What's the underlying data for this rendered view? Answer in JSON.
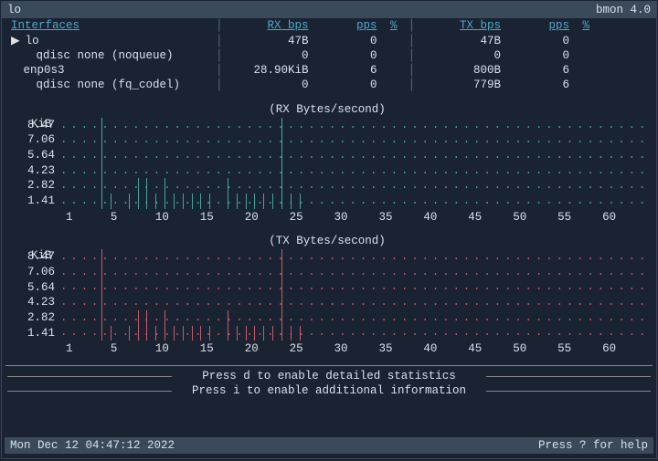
{
  "titlebar": {
    "left": "lo",
    "right": "bmon 4.0"
  },
  "table": {
    "headers": {
      "interfaces": "Interfaces",
      "rxbps": "RX bps",
      "pps1": "pps",
      "pct1": "%",
      "txbps": "TX bps",
      "pps2": "pps",
      "pct2": "%"
    },
    "rows": [
      {
        "name": "lo",
        "rx": "47B",
        "rxpps": "0",
        "tx": "47B",
        "txpps": "0",
        "selected": true,
        "indent": 1
      },
      {
        "name": "qdisc none (noqueue)",
        "rx": "0",
        "rxpps": "0",
        "tx": "0",
        "txpps": "0",
        "indent": 2
      },
      {
        "name": "enp0s3",
        "rx": "28.90KiB",
        "rxpps": "6",
        "tx": "800B",
        "txpps": "6",
        "indent": 1
      },
      {
        "name": "qdisc none (fq_codel)",
        "rx": "0",
        "rxpps": "0",
        "tx": "779B",
        "txpps": "6",
        "indent": 2
      }
    ]
  },
  "charts": {
    "rx": {
      "title": "(RX Bytes/second)",
      "unit": "KiB"
    },
    "tx": {
      "title": "(TX Bytes/second)",
      "unit": "KiB"
    },
    "y_ticks": [
      "8.47",
      "7.06",
      "5.64",
      "4.23",
      "2.82",
      "1.41"
    ],
    "x_ticks": [
      "1",
      "5",
      "10",
      "15",
      "20",
      "25",
      "30",
      "35",
      "40",
      "45",
      "50",
      "55",
      "60"
    ]
  },
  "chart_data": [
    {
      "type": "bar",
      "title": "(RX Bytes/second)",
      "ylabel": "KiB",
      "ylim": [
        0,
        8.47
      ],
      "series": [
        {
          "name": "RX",
          "x": [
            5,
            6,
            8,
            9,
            10,
            11,
            12,
            13,
            14,
            15,
            16,
            17,
            19,
            20,
            21,
            22,
            23,
            24,
            25,
            26,
            27
          ],
          "values": [
            8.47,
            1.41,
            1.41,
            2.82,
            2.82,
            1.41,
            2.82,
            1.41,
            1.41,
            1.41,
            1.41,
            1.41,
            2.82,
            1.41,
            1.41,
            1.41,
            1.41,
            1.41,
            8.47,
            1.41,
            1.41
          ]
        }
      ]
    },
    {
      "type": "bar",
      "title": "(TX Bytes/second)",
      "ylabel": "KiB",
      "ylim": [
        0,
        8.47
      ],
      "series": [
        {
          "name": "TX",
          "x": [
            5,
            6,
            8,
            9,
            10,
            11,
            12,
            13,
            14,
            15,
            16,
            17,
            19,
            20,
            21,
            22,
            23,
            24,
            25,
            26,
            27
          ],
          "values": [
            8.47,
            1.41,
            1.41,
            2.82,
            2.82,
            1.41,
            2.82,
            1.41,
            1.41,
            1.41,
            1.41,
            1.41,
            2.82,
            1.41,
            1.41,
            1.41,
            1.41,
            1.41,
            8.47,
            1.41,
            1.41
          ]
        }
      ]
    }
  ],
  "hints": {
    "d": "Press d to enable detailed statistics",
    "i": "Press i to enable additional information"
  },
  "statusbar": {
    "left": "Mon Dec 12 04:47:12 2022",
    "right": "Press ? for help"
  }
}
